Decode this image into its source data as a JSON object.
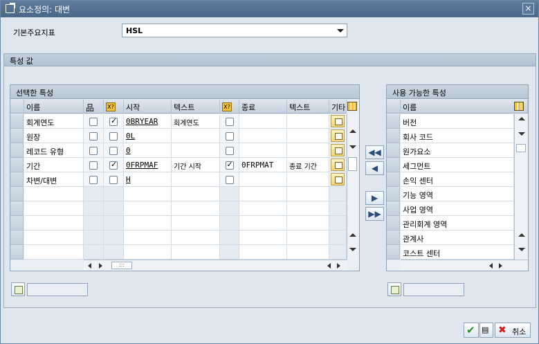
{
  "window": {
    "title": "요소정의: 대변",
    "close_label": "×"
  },
  "top": {
    "label": "기본주요지표",
    "value": "HSL"
  },
  "group": {
    "title": "특성 값"
  },
  "selected": {
    "title": "선택한 특성",
    "headers": [
      "이름",
      "",
      "",
      "시작",
      "텍스트",
      "",
      "종료",
      "텍스트",
      "기타"
    ],
    "rows": [
      {
        "name": "회계연도",
        "c1": false,
        "c2": true,
        "from": "0BRYEAR",
        "from_text": "회계연도",
        "c3": false,
        "to": "",
        "to_text": "",
        "other": true
      },
      {
        "name": "원장",
        "c1": false,
        "c2": false,
        "from": "0L",
        "from_text": "",
        "c3": false,
        "to": "",
        "to_text": "",
        "other": true
      },
      {
        "name": "레코드 유형",
        "c1": false,
        "c2": false,
        "from": "0",
        "from_text": "",
        "c3": false,
        "to": "",
        "to_text": "",
        "other": true
      },
      {
        "name": "기간",
        "c1": false,
        "c2": true,
        "from": "0FRPMAF",
        "from_text": "기간 시작",
        "c3": true,
        "to": "0FRPMAT",
        "to_text": "종료 기간",
        "other": true
      },
      {
        "name": "차변/대변",
        "c1": false,
        "c2": false,
        "from": "H",
        "from_text": "",
        "c3": false,
        "to": "",
        "to_text": "",
        "other": true
      }
    ],
    "empty_rows": 5,
    "hscroll_thumb": ":::"
  },
  "move_buttons": [
    "◀◀",
    "◀",
    "▶",
    "▶▶"
  ],
  "available": {
    "title": "사용 가능한 특성",
    "header": "이름",
    "items": [
      "버전",
      "회사 코드",
      "원가요소",
      "세그먼트",
      "손익 센터",
      "기능 영역",
      "사업 영역",
      "관리회계 영역",
      "관계사",
      "코스트 센터"
    ]
  },
  "footer": {
    "cancel_label": "취소"
  }
}
